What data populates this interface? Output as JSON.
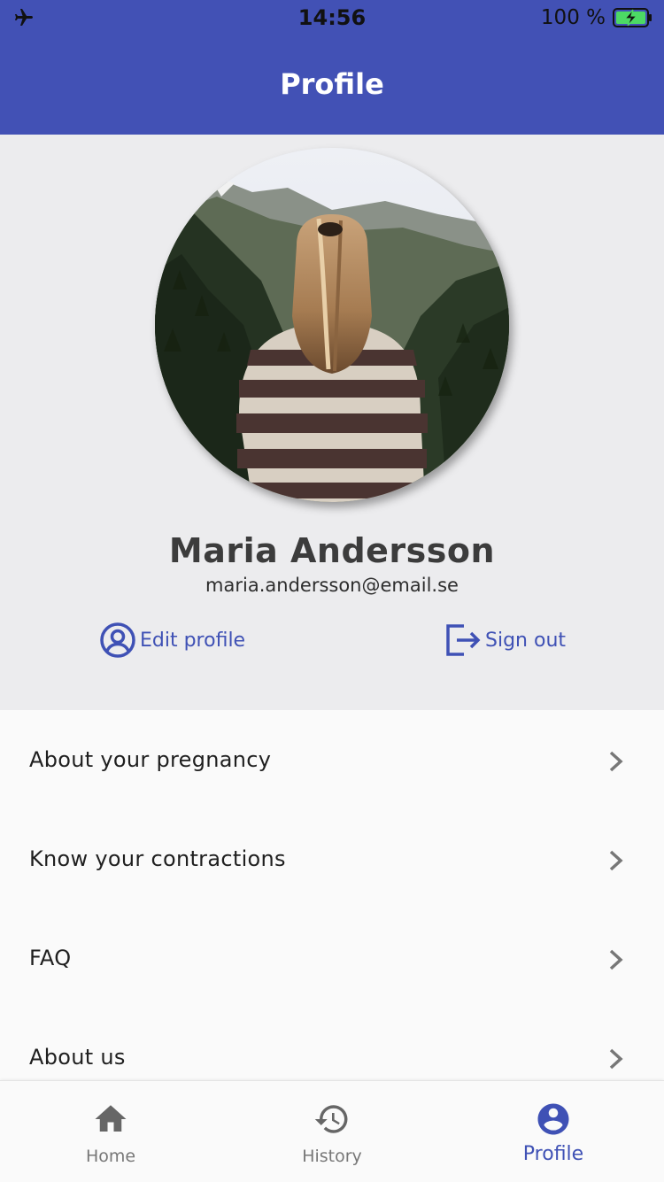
{
  "status_bar": {
    "time": "14:56",
    "battery": "100 %",
    "icons": [
      "airplane-icon",
      "battery-charging-icon"
    ]
  },
  "app_bar": {
    "title": "Profile",
    "color": "#4251b5"
  },
  "profile": {
    "name": "Maria Andersson",
    "email": "maria.andersson@email.se",
    "actions": {
      "edit_label": "Edit profile",
      "signout_label": "Sign out"
    }
  },
  "menu": {
    "items": [
      {
        "label": "About your pregnancy"
      },
      {
        "label": "Know your contractions"
      },
      {
        "label": "FAQ"
      },
      {
        "label": "About us"
      }
    ]
  },
  "bottom_nav": {
    "items": [
      {
        "label": "Home",
        "icon": "home-icon"
      },
      {
        "label": "History",
        "icon": "history-icon"
      },
      {
        "label": "Profile",
        "icon": "account-circle-icon",
        "active": true
      }
    ],
    "accent": "#3f51b5"
  }
}
